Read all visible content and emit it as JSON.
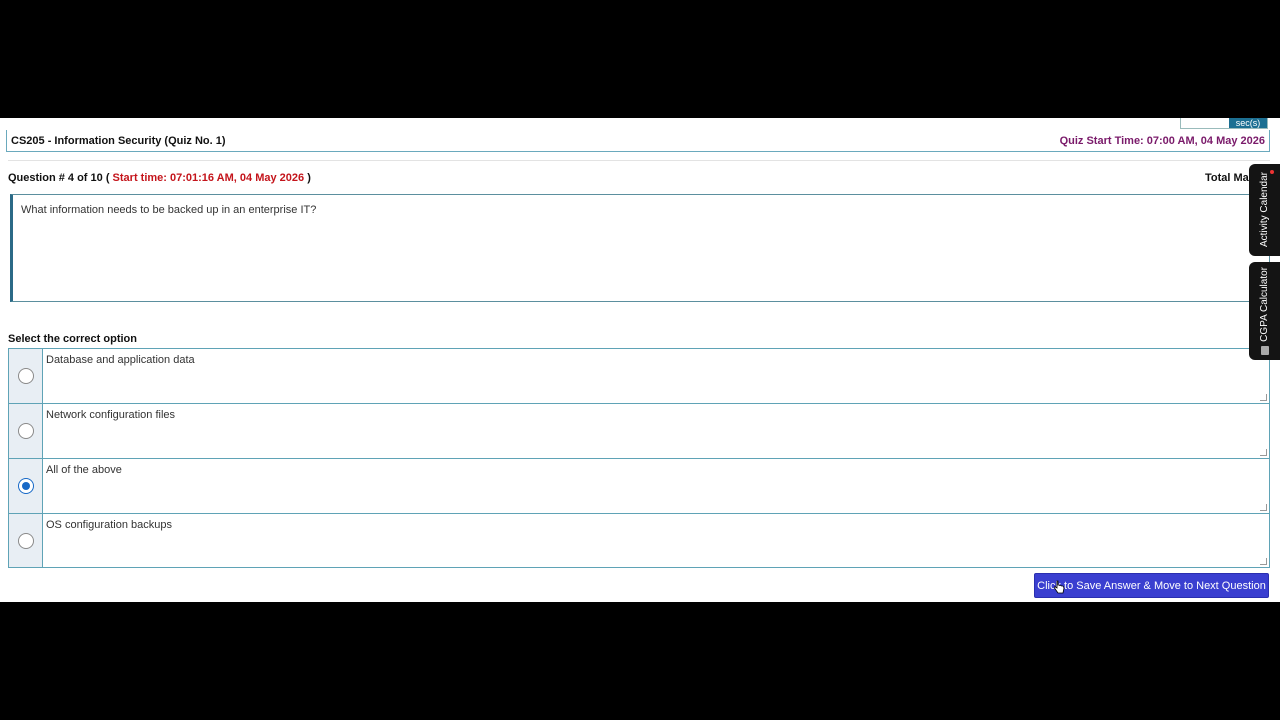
{
  "timer": {
    "unit_label": "sec(s)"
  },
  "header": {
    "course_title": "CS205 - Information Security (Quiz No. 1)",
    "quiz_start": "Quiz Start Time: 07:00 AM, 04 May 2026"
  },
  "question": {
    "number_label": "Question # 4 of 10",
    "open_paren": "(",
    "start_time": "Start time: 07:01:16 AM, 04 May 2026",
    "close_paren": ")",
    "total_marks_label": "Total Marks",
    "text": "What information needs to be backed up in an enterprise IT?"
  },
  "select_label": "Select the correct option",
  "options": [
    {
      "text": "Database and application data",
      "selected": false
    },
    {
      "text": "Network configuration files",
      "selected": false
    },
    {
      "text": "All of the above",
      "selected": true
    },
    {
      "text": "OS configuration backups",
      "selected": false
    }
  ],
  "save_button": "Click to Save Answer & Move to Next Question",
  "side_tabs": {
    "calendar": "Activity Calendar",
    "cgpa": "CGPA Calculator"
  },
  "colors": {
    "accent_blue": "#3a3fd0",
    "start_time_red": "#c4141b",
    "quiz_start_purple": "#7a1a6a",
    "border_teal": "#5fa3b6"
  }
}
